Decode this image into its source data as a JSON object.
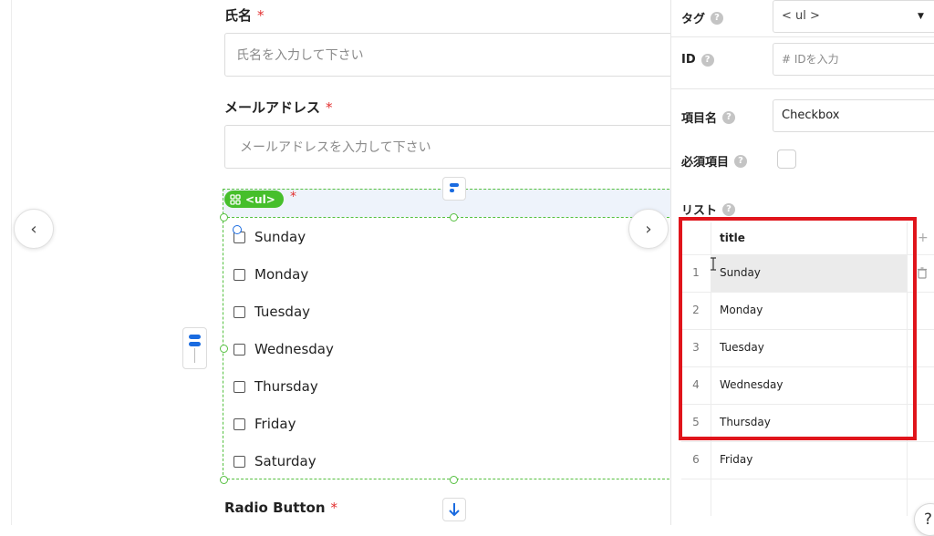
{
  "form": {
    "name_label": "氏名",
    "required_mark": "*",
    "name_placeholder": "氏名を入力して下さい",
    "email_label": "メールアドレス",
    "email_placeholder": "メールアドレスを入力して下さい",
    "radio_label": "Radio Button",
    "selected_tag": "<ul>",
    "checkbox_items": [
      "Sunday",
      "Monday",
      "Tuesday",
      "Wednesday",
      "Thursday",
      "Friday",
      "Saturday"
    ]
  },
  "nav": {
    "prev_icon": "‹",
    "next_icon": "›"
  },
  "panel": {
    "tag_label": "タグ",
    "tag_value": "< ul >",
    "id_label": "ID",
    "id_placeholder": "# IDを入力",
    "item_name_label": "項目名",
    "item_name_value": "Checkbox",
    "required_label": "必須項目",
    "list_label": "リスト",
    "help_icon": "?",
    "table": {
      "header": "title",
      "add_icon": "+",
      "rows": [
        {
          "num": "1",
          "title": "Sunday"
        },
        {
          "num": "2",
          "title": "Monday"
        },
        {
          "num": "3",
          "title": "Tuesday"
        },
        {
          "num": "4",
          "title": "Wednesday"
        },
        {
          "num": "5",
          "title": "Thursday"
        },
        {
          "num": "6",
          "title": "Friday"
        }
      ]
    }
  },
  "colors": {
    "accent_green": "#46bf2b",
    "required_red": "#e23030",
    "highlight_red": "#e0141b",
    "tool_blue": "#1a6be0"
  }
}
